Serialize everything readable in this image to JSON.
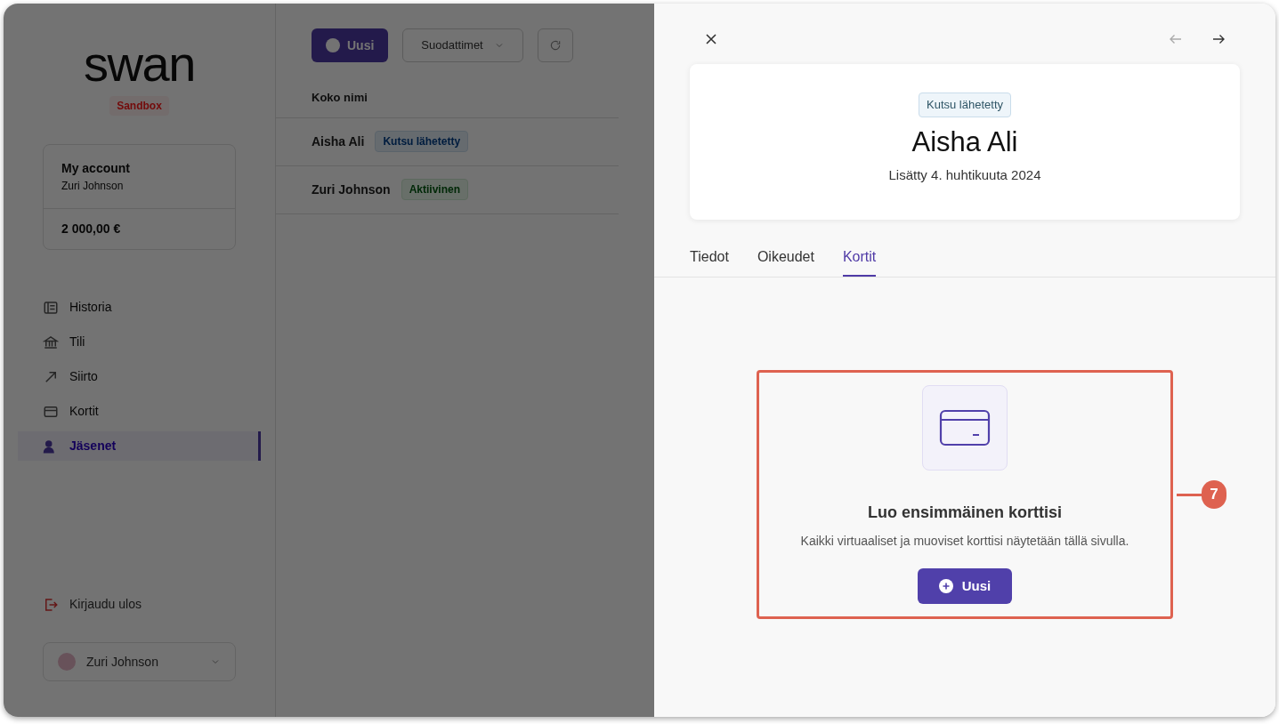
{
  "background_app": {
    "logo": "swan",
    "environment_badge": "Sandbox",
    "account_card": {
      "title": "My account",
      "subtitle": "Zuri Johnson",
      "balance": "2 000,00 €"
    },
    "sidebar": {
      "items": [
        {
          "label": "Historia",
          "kind": "history",
          "selected": false
        },
        {
          "label": "Tili",
          "kind": "bank",
          "selected": false
        },
        {
          "label": "Siirto",
          "kind": "transfer",
          "selected": false
        },
        {
          "label": "Kortit",
          "kind": "card",
          "selected": false
        },
        {
          "label": "Jäsenet",
          "kind": "members",
          "selected": true
        }
      ]
    },
    "logout": "Kirjaudu ulos",
    "user_menu": {
      "name": "Zuri Johnson"
    },
    "toolbar": {
      "new_button": "Uusi",
      "filters_button": "Suodattimet"
    },
    "table": {
      "column": "Koko nimi",
      "rows": [
        {
          "name": "Aisha Ali",
          "status": "Kutsu lähetetty",
          "kind": "invited"
        },
        {
          "name": "Zuri Johnson",
          "status": "Aktiivinen",
          "kind": "active"
        }
      ]
    }
  },
  "detail_panel": {
    "prev_disabled": true,
    "next_disabled": false,
    "header": {
      "status": "Kutsu lähetetty",
      "name": "Aisha Ali",
      "added": "Lisätty 4. huhtikuuta 2024"
    },
    "tabs": [
      {
        "label": "Tiedot",
        "selected": false
      },
      {
        "label": "Oikeudet",
        "selected": false
      },
      {
        "label": "Kortit",
        "selected": true
      }
    ],
    "empty_state": {
      "title": "Luo ensimmäinen korttisi",
      "description": "Kaikki virtuaaliset ja muoviset korttisi näytetään tällä sivulla.",
      "button": "Uusi"
    }
  },
  "annotation": {
    "number": "7"
  }
}
